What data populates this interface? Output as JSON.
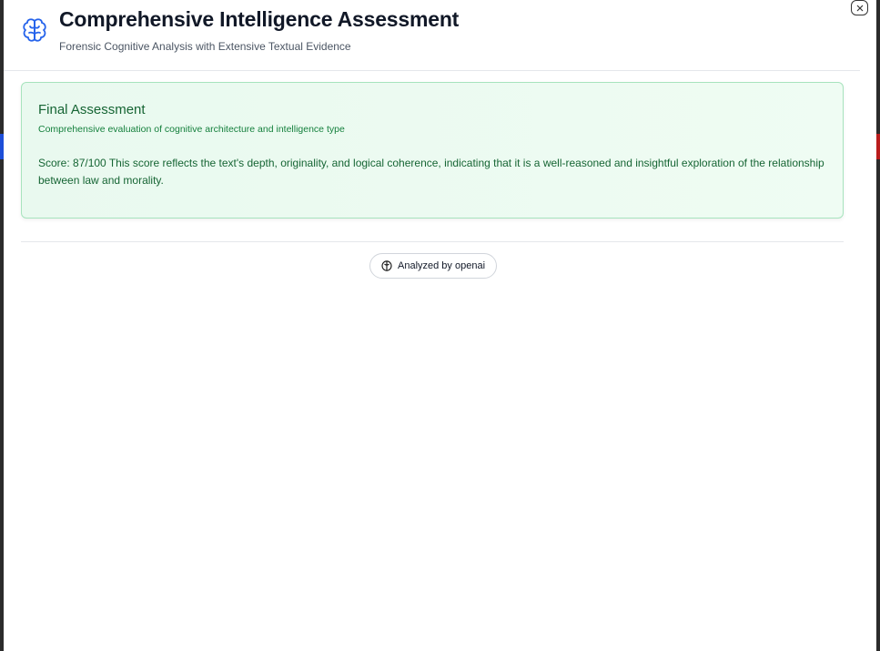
{
  "header": {
    "title": "Comprehensive Intelligence Assessment",
    "subtitle": "Forensic Cognitive Analysis with Extensive Textual Evidence",
    "icon": "brain-icon"
  },
  "final_assessment": {
    "title": "Final Assessment",
    "description": "Comprehensive evaluation of cognitive architecture and intelligence type",
    "body": "Score: 87/100 This score reflects the text's depth, originality, and logical coherence, indicating that it is a well-reasoned and insightful exploration of the relationship between law and morality."
  },
  "footer": {
    "badge_label": "Analyzed by openai",
    "badge_icon": "brain-icon"
  },
  "colors": {
    "accent_blue": "#2563eb",
    "card_bg": "#ecfbf1",
    "card_border": "#a7e3bd",
    "card_text": "#166534"
  }
}
